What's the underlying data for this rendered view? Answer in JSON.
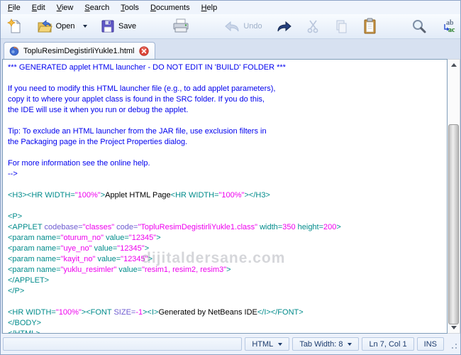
{
  "menu": {
    "items": [
      {
        "label": "File"
      },
      {
        "label": "Edit"
      },
      {
        "label": "View"
      },
      {
        "label": "Search"
      },
      {
        "label": "Tools"
      },
      {
        "label": "Documents"
      },
      {
        "label": "Help"
      }
    ]
  },
  "toolbar": {
    "open_label": "Open",
    "save_label": "Save",
    "undo_label": "Undo",
    "icons": [
      "new-document-icon",
      "open-folder-icon",
      "dropdown-arrow-icon",
      "save-floppy-icon",
      "print-icon",
      "undo-icon",
      "redo-icon",
      "cut-icon",
      "copy-icon",
      "paste-icon",
      "find-icon",
      "replace-icon"
    ]
  },
  "tab": {
    "title": "TopluResimDegistirliYukle1.html",
    "file_icon": "html-file-icon",
    "close_icon": "close-icon"
  },
  "editor": {
    "watermark": "dijitaldersane.com",
    "lines": [
      {
        "segs": [
          [
            "c",
            "*** GENERATED applet HTML launcher - DO NOT EDIT IN 'BUILD' FOLDER ***"
          ]
        ]
      },
      {
        "segs": []
      },
      {
        "segs": [
          [
            "c",
            "If you need to modify this HTML launcher file (e.g., to add applet parameters),"
          ]
        ]
      },
      {
        "segs": [
          [
            "c",
            "copy it to where your applet class is found in the SRC folder. If you do this,"
          ]
        ]
      },
      {
        "segs": [
          [
            "c",
            "the IDE will use it when you run or debug the applet."
          ]
        ]
      },
      {
        "segs": []
      },
      {
        "segs": [
          [
            "c",
            "Tip: To exclude an HTML launcher from the JAR file, use exclusion filters in"
          ]
        ]
      },
      {
        "segs": [
          [
            "c",
            "the Packaging page in the Project Properties dialog."
          ]
        ]
      },
      {
        "segs": []
      },
      {
        "segs": [
          [
            "c",
            "For more information see the online help."
          ]
        ]
      },
      {
        "segs": [
          [
            "c",
            "-->"
          ]
        ]
      },
      {
        "segs": []
      },
      {
        "segs": [
          [
            "t",
            "<H3><HR WIDTH="
          ],
          [
            "v",
            "\"100%\""
          ],
          [
            "t",
            ">"
          ],
          [
            "p",
            "Applet HTML Page"
          ],
          [
            "t",
            "<HR WIDTH="
          ],
          [
            "v",
            "\"100%\""
          ],
          [
            "t",
            "></H3>"
          ]
        ]
      },
      {
        "segs": []
      },
      {
        "segs": [
          [
            "t",
            "<P>"
          ]
        ]
      },
      {
        "segs": [
          [
            "t",
            "<APPLET "
          ],
          [
            "a",
            "codebase="
          ],
          [
            "v",
            "\"classes\""
          ],
          [
            "p",
            " "
          ],
          [
            "a",
            "code="
          ],
          [
            "v",
            "\"TopluResimDegistirliYukle1.class\""
          ],
          [
            "t",
            " width="
          ],
          [
            "v",
            "350"
          ],
          [
            "t",
            " height="
          ],
          [
            "v",
            "200"
          ],
          [
            "t",
            ">"
          ]
        ]
      },
      {
        "segs": [
          [
            "t",
            "<param name="
          ],
          [
            "v",
            "\"oturum_no\""
          ],
          [
            "t",
            " value="
          ],
          [
            "v",
            "\"12345\""
          ],
          [
            "t",
            ">"
          ]
        ]
      },
      {
        "segs": [
          [
            "t",
            "<param name="
          ],
          [
            "v",
            "\"uye_no\""
          ],
          [
            "t",
            " value="
          ],
          [
            "v",
            "\"12345\""
          ],
          [
            "t",
            ">"
          ]
        ]
      },
      {
        "segs": [
          [
            "t",
            "<param name="
          ],
          [
            "v",
            "\"kayit_no\""
          ],
          [
            "t",
            " value="
          ],
          [
            "v",
            "\"12345\""
          ],
          [
            "t",
            ">"
          ]
        ]
      },
      {
        "segs": [
          [
            "t",
            "<param name="
          ],
          [
            "v",
            "\"yuklu_resimler\""
          ],
          [
            "t",
            " value="
          ],
          [
            "v",
            "\"resim1, resim2, resim3\""
          ],
          [
            "t",
            ">"
          ]
        ]
      },
      {
        "segs": [
          [
            "t",
            "</APPLET>"
          ]
        ]
      },
      {
        "segs": [
          [
            "t",
            "</P>"
          ]
        ]
      },
      {
        "segs": []
      },
      {
        "segs": [
          [
            "t",
            "<HR WIDTH="
          ],
          [
            "v",
            "\"100%\""
          ],
          [
            "t",
            "><FONT "
          ],
          [
            "a",
            "SIZE="
          ],
          [
            "v",
            "-1"
          ],
          [
            "t",
            "><I>"
          ],
          [
            "p",
            "Generated by NetBeans IDE"
          ],
          [
            "t",
            "</I></FONT>"
          ]
        ]
      },
      {
        "segs": [
          [
            "t",
            "</BODY>"
          ]
        ]
      },
      {
        "segs": [
          [
            "t",
            "</HTML>"
          ]
        ]
      }
    ]
  },
  "statusbar": {
    "language": "HTML",
    "tab_width": "Tab Width: 8",
    "position": "Ln 7, Col 1",
    "mode": "INS"
  },
  "colors": {
    "comment": "#0000EE",
    "tag": "#008B8B",
    "attr": "#6E5BD0",
    "value": "#EE00EE",
    "plain": "#000000",
    "close_red": "#D6382F",
    "toolbar_disabled": "#C7D3E8"
  }
}
